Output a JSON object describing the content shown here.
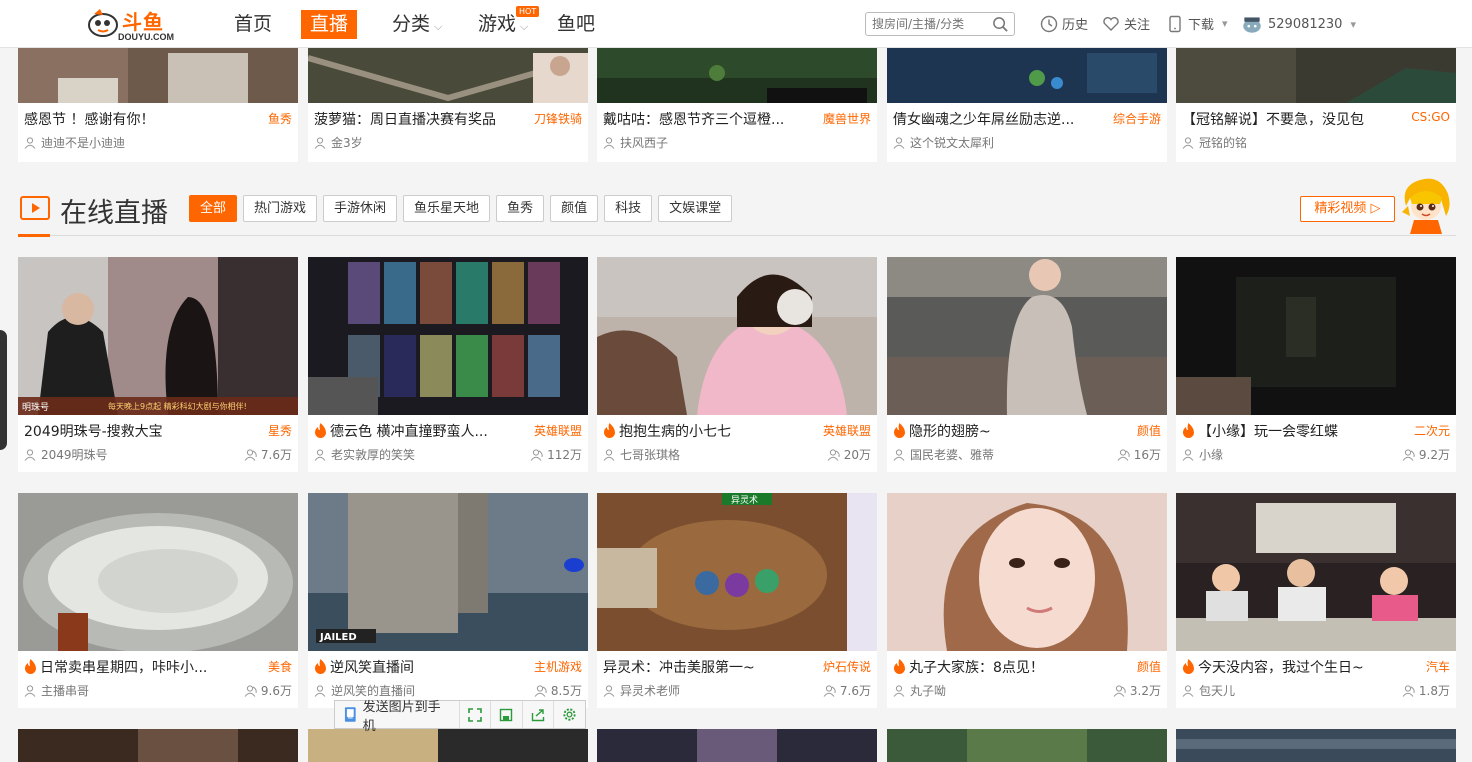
{
  "app": {
    "brand": "斗鱼",
    "brand_sub": "DOUYU.COM"
  },
  "nav": {
    "items": [
      {
        "label": "首页",
        "active": false
      },
      {
        "label": "直播",
        "active": true
      },
      {
        "label": "分类",
        "active": false
      },
      {
        "label": "游戏",
        "active": false
      },
      {
        "label": "鱼吧",
        "active": false
      }
    ],
    "hot_badge": "HOT"
  },
  "search": {
    "placeholder": "搜房间/主播/分类"
  },
  "toolbar": {
    "history": "历史",
    "follow": "关注",
    "download": "下载",
    "user_id": "529081230"
  },
  "top_row": [
    {
      "title": "感恩节 ！感谢有你！",
      "category": "鱼秀",
      "owner": "迪迪不是小迪迪"
    },
    {
      "title": "菠萝猫：周日直播决赛有奖品",
      "category": "刀锋铁骑",
      "owner": "金3岁"
    },
    {
      "title": "戴咕咕：感恩节齐三个逗橙...",
      "category": "魔兽世界",
      "owner": "扶风西子"
    },
    {
      "title": "倩女幽魂之少年屌丝励志逆...",
      "category": "综合手游",
      "owner": "这个锐文太犀利"
    },
    {
      "title": "【冠铭解说】不要急，没见包",
      "category": "CS:GO",
      "owner": "冠铭的铭"
    }
  ],
  "section": {
    "title": "在线直播",
    "filters": [
      "全部",
      "热门游戏",
      "手游休闲",
      "鱼乐星天地",
      "鱼秀",
      "颜值",
      "科技",
      "文娱课堂"
    ],
    "highlight_button": "精彩视频 ▷"
  },
  "row1": [
    {
      "title": "2049明珠号-搜救大宝",
      "category": "星秀",
      "owner": "2049明珠号",
      "views": "7.6万",
      "fire": false
    },
    {
      "title": "德云色 横冲直撞野蛮人...",
      "category": "英雄联盟",
      "owner": "老实敦厚的笑笑",
      "views": "112万",
      "fire": true
    },
    {
      "title": "抱抱生病的小七七",
      "category": "英雄联盟",
      "owner": "七哥张琪格",
      "views": "20万",
      "fire": true
    },
    {
      "title": "隐形的翅膀~",
      "category": "颜值",
      "owner": "国民老婆、雅蒂",
      "views": "16万",
      "fire": true
    },
    {
      "title": "【小缘】玩一会零红蝶",
      "category": "二次元",
      "owner": "小缘",
      "views": "9.2万",
      "fire": true
    }
  ],
  "row2": [
    {
      "title": "日常卖串星期四，咔咔小...",
      "category": "美食",
      "owner": "主播串哥",
      "views": "9.6万",
      "fire": true
    },
    {
      "title": "逆风笑直播间",
      "category": "主机游戏",
      "owner": "逆风笑的直播间",
      "views": "8.5万",
      "fire": true
    },
    {
      "title": "异灵术：冲击美服第一~",
      "category": "炉石传说",
      "owner": "异灵术老师",
      "views": "7.6万",
      "fire": false
    },
    {
      "title": "丸子大家族：8点见！",
      "category": "颜值",
      "owner": "丸子呦",
      "views": "3.2万",
      "fire": true
    },
    {
      "title": "今天没内容，我过个生日~",
      "category": "汽车",
      "owner": "包天儿",
      "views": "1.8万",
      "fire": true
    }
  ],
  "thumb_text": {
    "r1c1_banner": "每天晚上9点起  精彩科幻大剧与你相伴!",
    "r1c1_tag": "明珠号",
    "r2c2_tag": "JAILED",
    "r2c3_tag": "异灵术"
  },
  "floatbar": {
    "send_label": "发送图片到手机"
  }
}
